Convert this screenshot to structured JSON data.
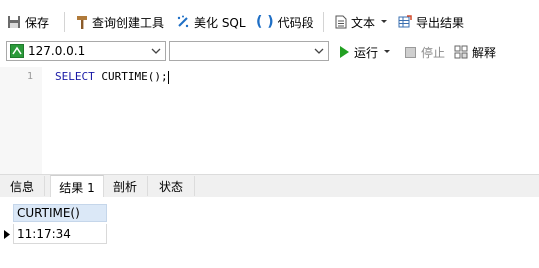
{
  "toolbar": {
    "save": "保存",
    "query_builder": "查询创建工具",
    "beautify": "美化 SQL",
    "snippet": "代码段",
    "text": "文本",
    "export": "导出结果"
  },
  "connection": {
    "selected": "127.0.0.1",
    "database": ""
  },
  "run_bar": {
    "run": "运行",
    "stop": "停止",
    "explain": "解释"
  },
  "editor": {
    "line_number": "1",
    "keyword": "SELECT",
    "code_rest": " CURTIME();"
  },
  "tabs": [
    {
      "label": "信息"
    },
    {
      "label": "结果 1"
    },
    {
      "label": "剖析"
    },
    {
      "label": "状态"
    }
  ],
  "result": {
    "column": "CURTIME()",
    "value": "11:17:34"
  },
  "colors": {
    "run_green": "#22a022",
    "header_blue": "#dbe8f7"
  }
}
